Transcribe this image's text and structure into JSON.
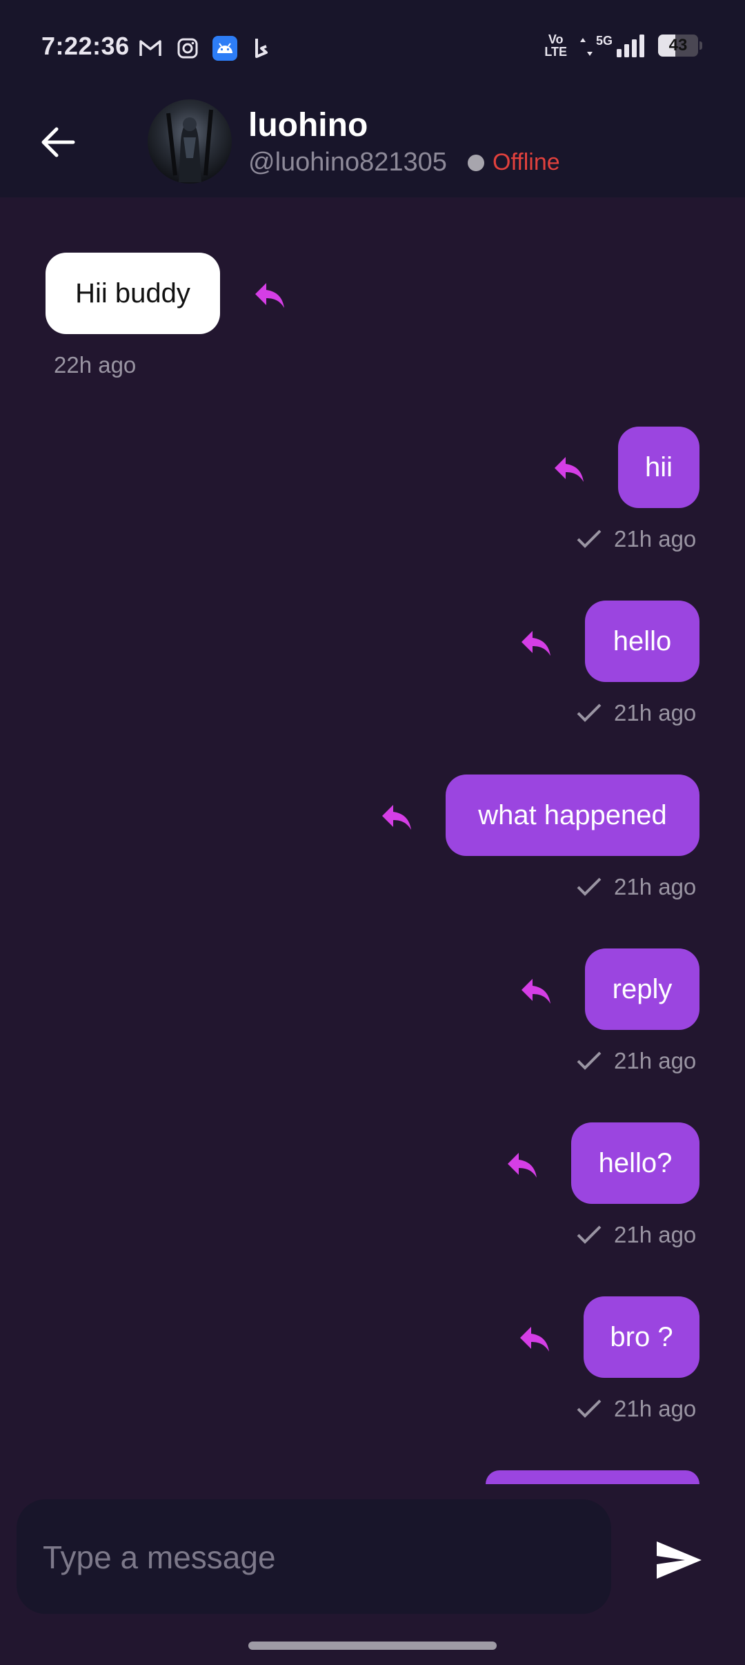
{
  "status_bar": {
    "time": "7:22:36",
    "apps": [
      "gmail-icon",
      "instagram-icon",
      "android-icon",
      "bing-icon"
    ],
    "network": "VoLTE",
    "net_type": "5G",
    "battery": "43"
  },
  "header": {
    "name": "luohino",
    "handle": "@luohino821305",
    "status": "Offline",
    "status_color": "#e2413d"
  },
  "messages": [
    {
      "text": "Hii buddy",
      "time": "22h ago",
      "direction": "incoming"
    },
    {
      "text": "hii",
      "time": "21h ago",
      "direction": "outgoing"
    },
    {
      "text": "hello",
      "time": "21h ago",
      "direction": "outgoing"
    },
    {
      "text": "what happened",
      "time": "21h ago",
      "direction": "outgoing"
    },
    {
      "text": "reply",
      "time": "21h ago",
      "direction": "outgoing"
    },
    {
      "text": "hello?",
      "time": "21h ago",
      "direction": "outgoing"
    },
    {
      "text": "bro ?",
      "time": "21h ago",
      "direction": "outgoing"
    }
  ],
  "composer": {
    "placeholder": "Type a message",
    "value": ""
  },
  "colors": {
    "accent": "#9b45e0",
    "reply_icon": "#d53ee6",
    "background": "#22162f",
    "bar": "#18152a"
  }
}
